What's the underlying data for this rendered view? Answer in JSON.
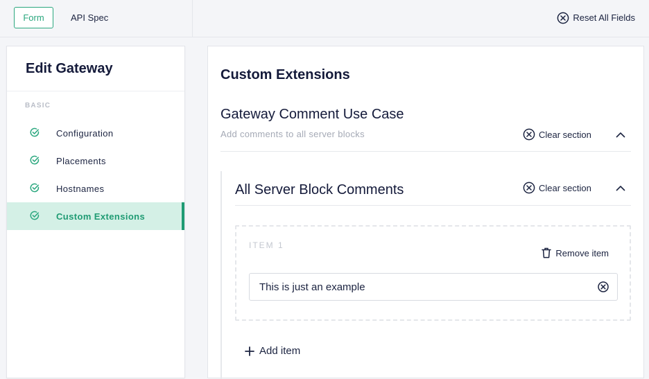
{
  "header": {
    "tabs": [
      {
        "label": "Form",
        "active": true
      },
      {
        "label": "API Spec",
        "active": false
      }
    ],
    "reset_label": "Reset All Fields",
    "reset_icon": "x-circle-icon"
  },
  "sidebar": {
    "title": "Edit Gateway",
    "section_label": "BASIC",
    "items": [
      {
        "label": "Configuration",
        "icon": "check-icon",
        "active": false
      },
      {
        "label": "Placements",
        "icon": "check-icon",
        "active": false
      },
      {
        "label": "Hostnames",
        "icon": "check-icon",
        "active": false
      },
      {
        "label": "Custom Extensions",
        "icon": "check-icon",
        "active": true
      }
    ]
  },
  "main": {
    "title": "Custom Extensions",
    "section": {
      "title": "Gateway Comment Use Case",
      "description": "Add comments to all server blocks",
      "clear_label": "Clear section"
    },
    "subsection": {
      "title": "All Server Block Comments",
      "clear_label": "Clear section",
      "items": [
        {
          "label": "ITEM 1",
          "remove_label": "Remove item",
          "value": "This is just an example"
        }
      ],
      "add_label": "Add item"
    }
  },
  "colors": {
    "accent": "#1f9b73",
    "active_bg": "#d4f0e6",
    "text": "#1b2340",
    "muted": "#a4a9b5"
  }
}
